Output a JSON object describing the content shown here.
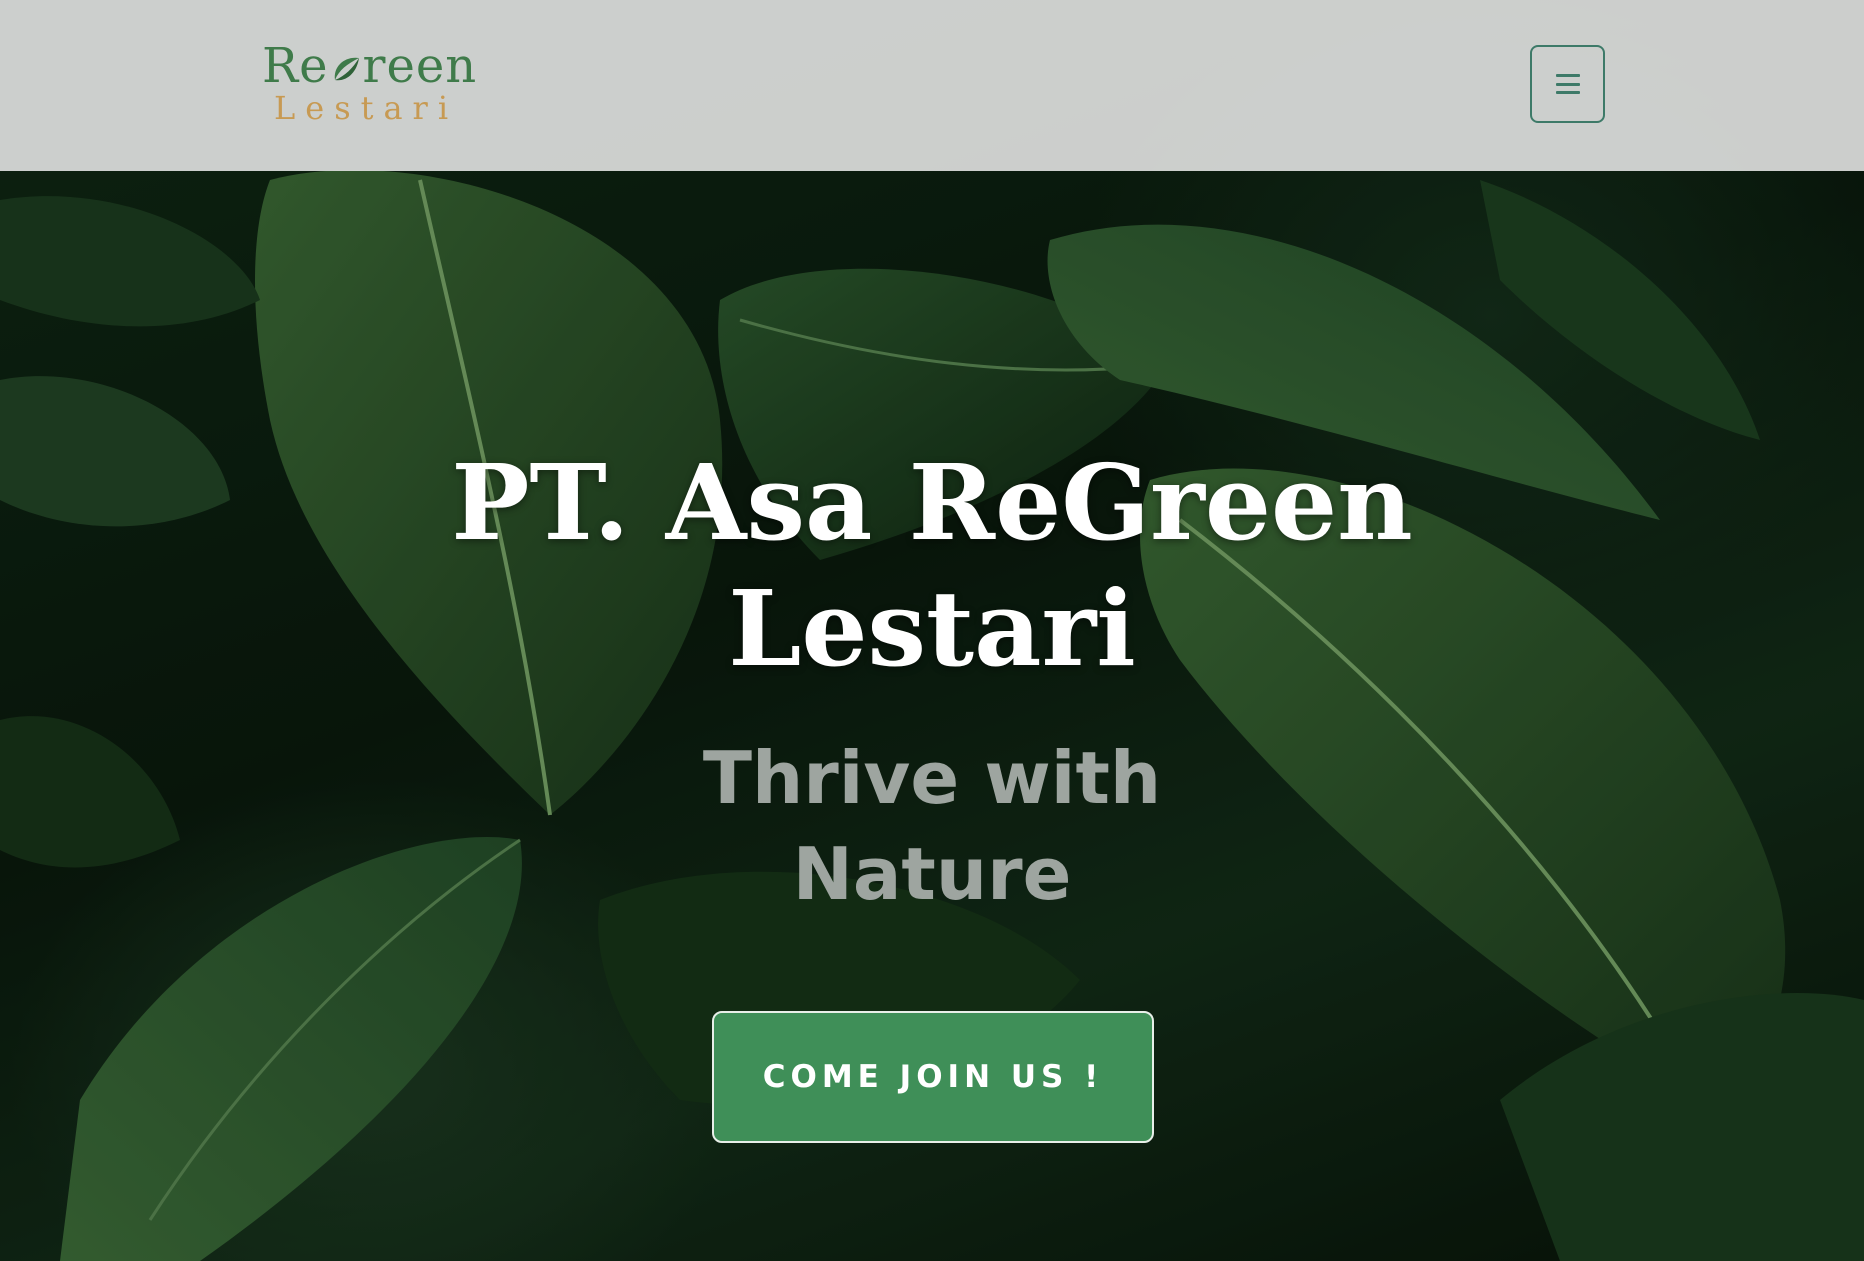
{
  "header": {
    "logo": {
      "brand_part1": "Re",
      "brand_part2": "reen",
      "brand_sub": "Lestari",
      "leaf_icon": "leaf-icon",
      "colors": {
        "primary": "#3f7b4a",
        "secondary": "#c79a53"
      }
    },
    "menu_button": {
      "icon": "hamburger-menu-icon",
      "color": "#3d7a68"
    }
  },
  "hero": {
    "title_line1": "PT. Asa ReGreen",
    "title_line2": "Lestari",
    "subtitle_line1": "Thrive with",
    "subtitle_line2": "Nature",
    "cta_label": "COME JOIN US !",
    "cta_color": "#3f8f58"
  }
}
